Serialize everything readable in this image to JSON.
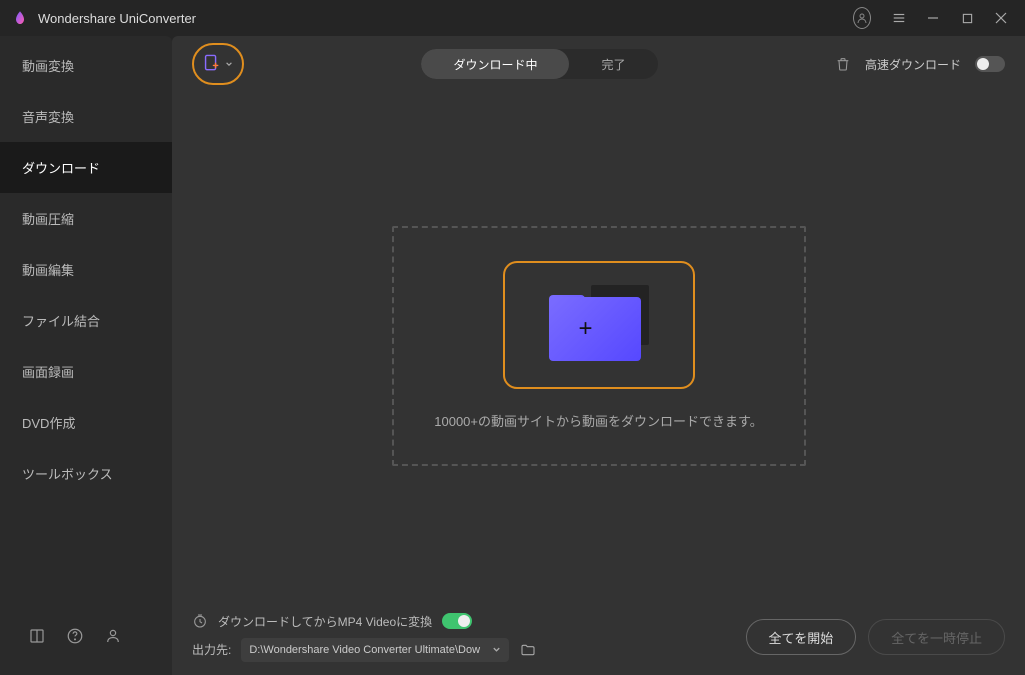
{
  "titlebar": {
    "title": "Wondershare UniConverter"
  },
  "sidebar": {
    "items": [
      {
        "label": "動画変換"
      },
      {
        "label": "音声変換"
      },
      {
        "label": "ダウンロード"
      },
      {
        "label": "動画圧縮"
      },
      {
        "label": "動画編集"
      },
      {
        "label": "ファイル結合"
      },
      {
        "label": "画面録画"
      },
      {
        "label": "DVD作成"
      },
      {
        "label": "ツールボックス"
      }
    ],
    "active_index": 2
  },
  "toolbar": {
    "tabs": [
      {
        "label": "ダウンロード中"
      },
      {
        "label": "完了"
      }
    ],
    "active_tab": 0,
    "fast_download_label": "高速ダウンロード",
    "fast_download_enabled": false
  },
  "dropzone": {
    "description": "10000+の動画サイトから動画をダウンロードできます。"
  },
  "bottombar": {
    "convert_label_prefix": "ダウンロードしてからMP4 Videoに変換",
    "convert_enabled": true,
    "output_label": "出力先:",
    "output_path": "D:\\Wondershare Video Converter Ultimate\\Dow",
    "start_all": "全てを開始",
    "pause_all": "全てを一時停止"
  }
}
